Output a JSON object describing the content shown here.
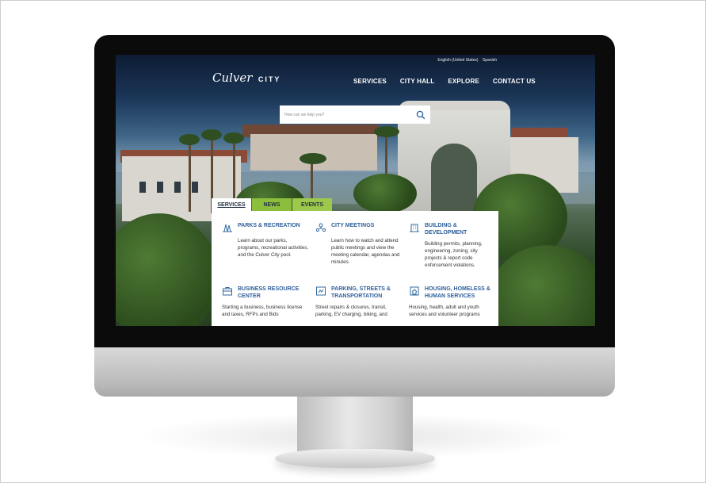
{
  "site": {
    "logo_script": "Culver",
    "logo_city": "CITY",
    "languages": [
      "English (United States)",
      "Spanish"
    ]
  },
  "nav": [
    "SERVICES",
    "CITY HALL",
    "EXPLORE",
    "CONTACT US"
  ],
  "search": {
    "placeholder": "How can we help you?",
    "icon": "search-icon"
  },
  "tabs": [
    {
      "label": "SERVICES",
      "active": true
    },
    {
      "label": "NEWS",
      "active": false
    },
    {
      "label": "EVENTS",
      "active": false
    }
  ],
  "services": [
    {
      "title": "PARKS & RECREATION",
      "icon": "parks-icon",
      "description": "Learn about our parks, programs, recreational activities, and the Culver City pool."
    },
    {
      "title": "CITY MEETINGS",
      "icon": "meetings-icon",
      "description": "Learn how to watch and attend public meetings and view the meeting calendar, agendas and minutes."
    },
    {
      "title": "BUILDING & DEVELOPMENT",
      "icon": "building-icon",
      "description": "Building permits, planning, engineering, zoning, city projects & report code enforcement violations."
    },
    {
      "title": "BUSINESS RESOURCE CENTER",
      "icon": "business-icon",
      "description": "Starting a business, business license and taxes, RFPs and Bids"
    },
    {
      "title": "PARKING, STREETS & TRANSPORTATION",
      "icon": "parking-icon",
      "description": "Street repairs & closures, transit, parking, EV charging, biking, and"
    },
    {
      "title": "HOUSING, HOMELESS & HUMAN SERVICES",
      "icon": "housing-icon",
      "description": "Housing, health, adult and youth services and volunteer programs"
    }
  ],
  "colors": {
    "accent_blue": "#2d5f9a",
    "tab_green": "#8dbd3c",
    "bezel": "#0b0b0b"
  }
}
